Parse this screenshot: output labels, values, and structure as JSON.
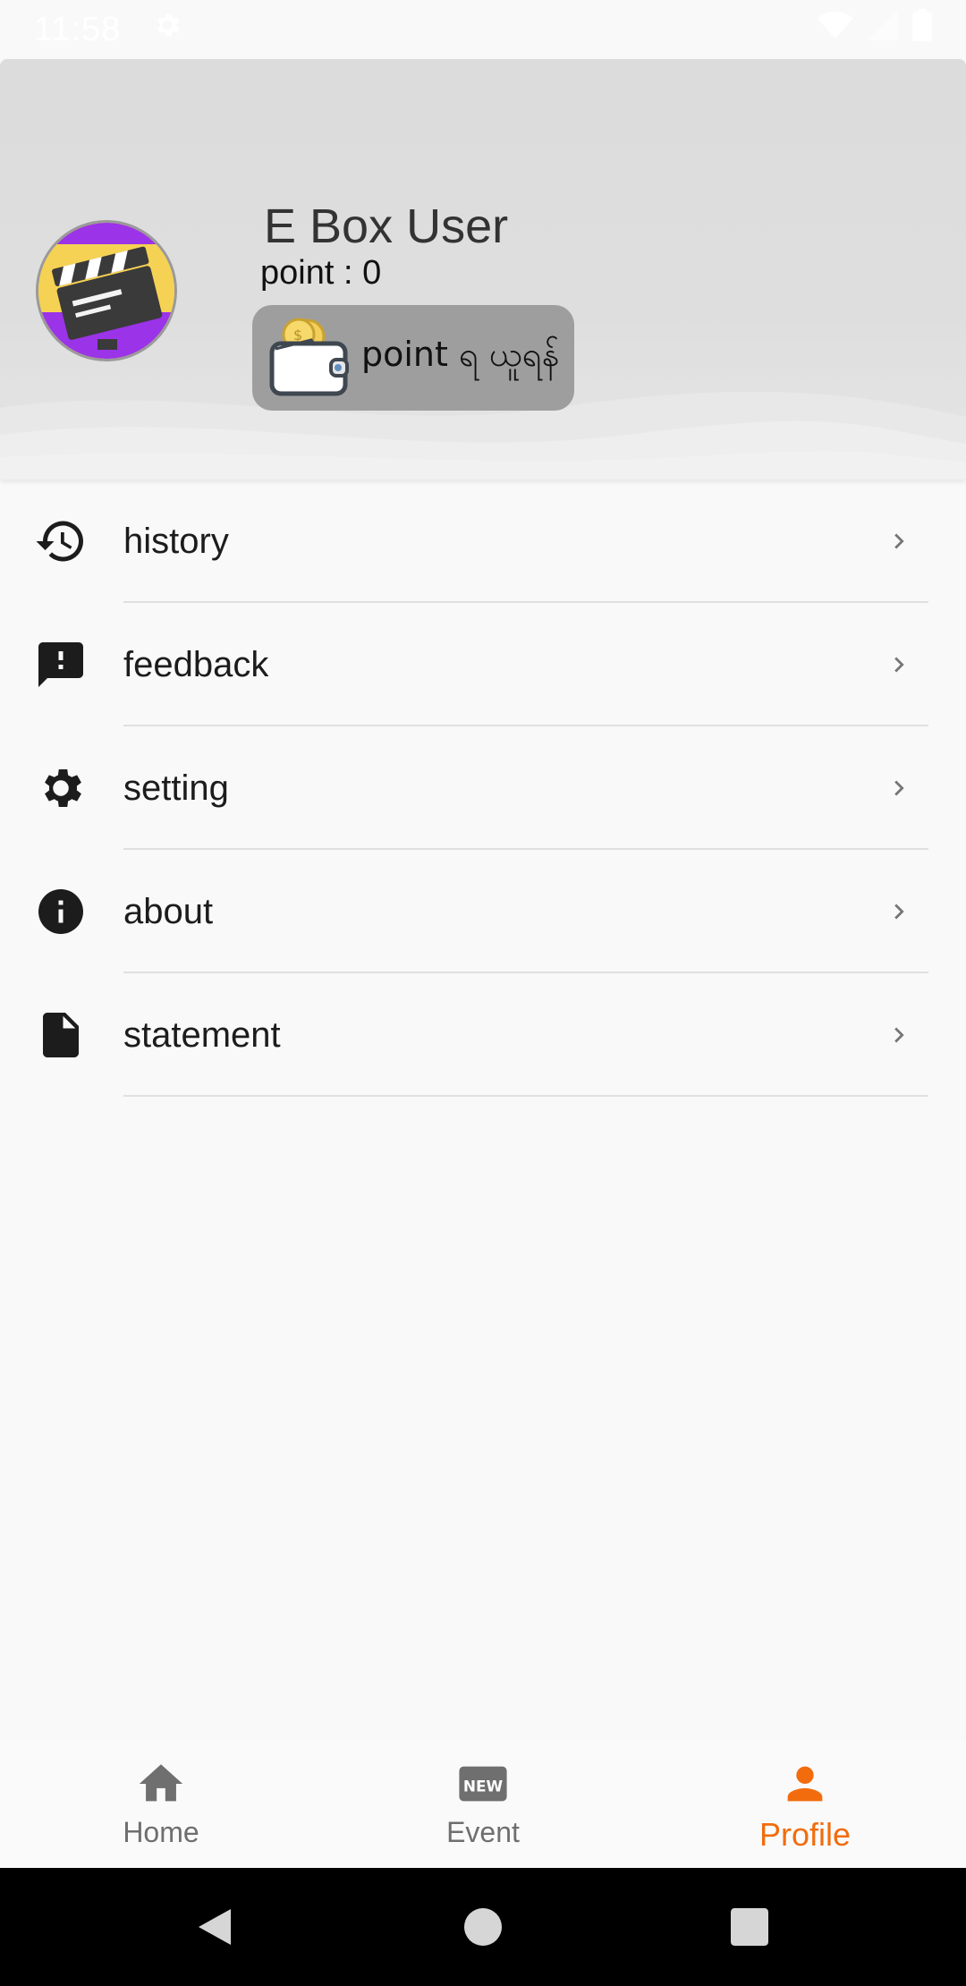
{
  "status_bar": {
    "time": "11:58"
  },
  "profile": {
    "username": "E Box User",
    "points_text": "point : 0",
    "redeem_button_label": "point ရ ယူရန်"
  },
  "menu": {
    "items": [
      {
        "label": "history",
        "icon": "history-icon"
      },
      {
        "label": "feedback",
        "icon": "feedback-icon"
      },
      {
        "label": "setting",
        "icon": "gear-icon"
      },
      {
        "label": "about",
        "icon": "info-icon"
      },
      {
        "label": "statement",
        "icon": "document-icon"
      }
    ]
  },
  "bottom_nav": {
    "items": [
      {
        "label": "Home",
        "icon": "home-icon"
      },
      {
        "label": "Event",
        "icon": "new-badge-icon",
        "badge_text": "NEW"
      },
      {
        "label": "Profile",
        "icon": "person-icon",
        "active": true
      }
    ]
  },
  "colors": {
    "accent": "#f26c0d",
    "header_bg": "#dcdcdc",
    "redeem_button_bg": "#9e9e9e",
    "icon_dark": "#1c1c1c",
    "nav_inactive": "#6f6f6f"
  }
}
